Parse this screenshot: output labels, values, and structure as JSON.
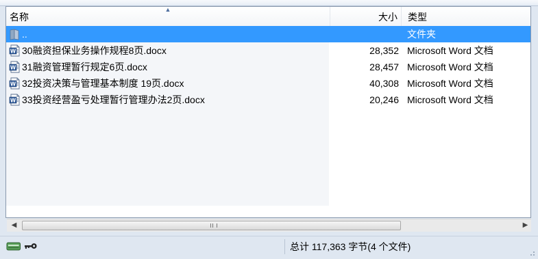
{
  "columns": {
    "name": "名称",
    "size": "大小",
    "type": "类型"
  },
  "rows": [
    {
      "name": "..",
      "size": "",
      "type": "文件夹",
      "icon": "folder-up-icon",
      "selected": true
    },
    {
      "name": "30融资担保业务操作规程8页.docx",
      "size": "28,352",
      "type": "Microsoft Word 文档",
      "icon": "word-doc-icon",
      "selected": false
    },
    {
      "name": "31融资管理暂行规定6页.docx",
      "size": "28,457",
      "type": "Microsoft Word 文档",
      "icon": "word-doc-icon",
      "selected": false
    },
    {
      "name": "32投资决策与管理基本制度 19页.docx",
      "size": "40,308",
      "type": "Microsoft Word 文档",
      "icon": "word-doc-icon",
      "selected": false
    },
    {
      "name": "33投资经营盈亏处理暂行管理办法2页.docx",
      "size": "20,246",
      "type": "Microsoft Word 文档",
      "icon": "word-doc-icon",
      "selected": false
    }
  ],
  "status": {
    "summary": "总计 117,363 字节(4 个文件)"
  },
  "colors": {
    "selection": "#3399ff",
    "name_column_bg": "#f4f6f9",
    "window_bg": "#dfe7f1"
  }
}
